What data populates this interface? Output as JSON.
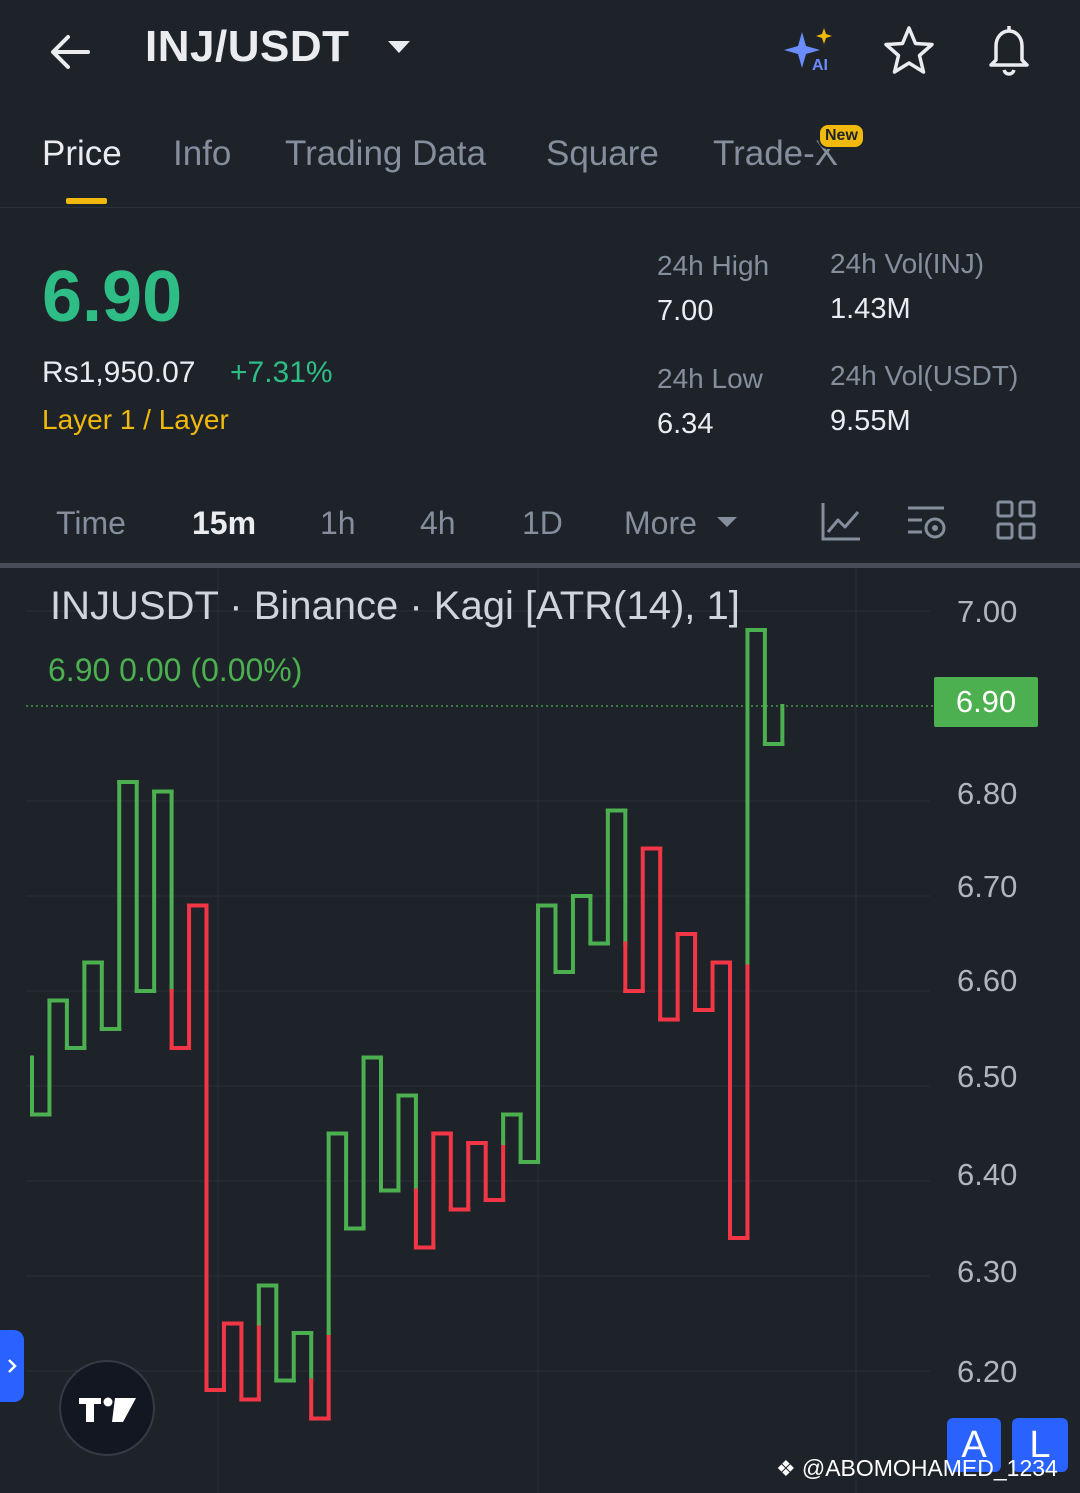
{
  "header": {
    "pair": "INJ/USDT",
    "icons": [
      "back-arrow-icon",
      "ai-sparkle-icon",
      "star-icon",
      "bell-icon"
    ]
  },
  "tabs": [
    {
      "label": "Price",
      "active": true
    },
    {
      "label": "Info"
    },
    {
      "label": "Trading Data"
    },
    {
      "label": "Square"
    },
    {
      "label": "Trade-X",
      "badge": "New"
    }
  ],
  "price": {
    "last": "6.90",
    "fiat": "Rs1,950.07",
    "change_pct": "+7.31%",
    "tag": "Layer 1 / Layer"
  },
  "stats": {
    "high_label": "24h High",
    "high": "7.00",
    "low_label": "24h Low",
    "low": "6.34",
    "vol_base_label": "24h Vol(INJ)",
    "vol_base": "1.43M",
    "vol_quote_label": "24h Vol(USDT)",
    "vol_quote": "9.55M"
  },
  "timeframes": [
    "Time",
    "15m",
    "1h",
    "4h",
    "1D",
    "More"
  ],
  "active_timeframe": "15m",
  "tool_icons": [
    "indicator-chart-icon",
    "chart-settings-icon",
    "layout-grid-icon"
  ],
  "chart": {
    "title": "INJUSDT · Binance · Kagi [ATR(14), 1]",
    "ohlc": "6.90  0.00 (0.00%)",
    "last_label": "6.90",
    "ticks": [
      "7.00",
      "6.80",
      "6.70",
      "6.60",
      "6.50",
      "6.40",
      "6.30",
      "6.20"
    ]
  },
  "chart_data": {
    "type": "line",
    "style": "kagi",
    "title": "INJUSDT · Binance · Kagi [ATR(14), 1]",
    "ylim": [
      6.13,
      7.03
    ],
    "y_ticks": [
      7.0,
      6.8,
      6.7,
      6.6,
      6.5,
      6.4,
      6.3,
      6.2
    ],
    "last_price": 6.9,
    "colors": {
      "yang": "#4caf50",
      "yin": "#f23645"
    },
    "segments": [
      {
        "x": 0,
        "from": 6.53,
        "to": 6.47
      },
      {
        "x": 1,
        "from": 6.47,
        "to": 6.59
      },
      {
        "x": 2,
        "from": 6.59,
        "to": 6.54
      },
      {
        "x": 3,
        "from": 6.54,
        "to": 6.63
      },
      {
        "x": 4,
        "from": 6.63,
        "to": 6.56
      },
      {
        "x": 5,
        "from": 6.56,
        "to": 6.82
      },
      {
        "x": 6,
        "from": 6.82,
        "to": 6.6
      },
      {
        "x": 7,
        "from": 6.6,
        "to": 6.81
      },
      {
        "x": 8,
        "from": 6.81,
        "to": 6.54
      },
      {
        "x": 9,
        "from": 6.54,
        "to": 6.69
      },
      {
        "x": 10,
        "from": 6.69,
        "to": 6.18
      },
      {
        "x": 11,
        "from": 6.18,
        "to": 6.25
      },
      {
        "x": 12,
        "from": 6.25,
        "to": 6.17
      },
      {
        "x": 13,
        "from": 6.17,
        "to": 6.29
      },
      {
        "x": 14,
        "from": 6.29,
        "to": 6.19
      },
      {
        "x": 15,
        "from": 6.19,
        "to": 6.24
      },
      {
        "x": 16,
        "from": 6.24,
        "to": 6.15
      },
      {
        "x": 17,
        "from": 6.15,
        "to": 6.45
      },
      {
        "x": 18,
        "from": 6.45,
        "to": 6.35
      },
      {
        "x": 19,
        "from": 6.35,
        "to": 6.53
      },
      {
        "x": 20,
        "from": 6.53,
        "to": 6.39
      },
      {
        "x": 21,
        "from": 6.39,
        "to": 6.49
      },
      {
        "x": 22,
        "from": 6.49,
        "to": 6.33
      },
      {
        "x": 23,
        "from": 6.33,
        "to": 6.45
      },
      {
        "x": 24,
        "from": 6.45,
        "to": 6.37
      },
      {
        "x": 25,
        "from": 6.37,
        "to": 6.44
      },
      {
        "x": 26,
        "from": 6.44,
        "to": 6.38
      },
      {
        "x": 27,
        "from": 6.38,
        "to": 6.47
      },
      {
        "x": 28,
        "from": 6.47,
        "to": 6.42
      },
      {
        "x": 29,
        "from": 6.42,
        "to": 6.69
      },
      {
        "x": 30,
        "from": 6.69,
        "to": 6.62
      },
      {
        "x": 31,
        "from": 6.62,
        "to": 6.7
      },
      {
        "x": 32,
        "from": 6.7,
        "to": 6.65
      },
      {
        "x": 33,
        "from": 6.65,
        "to": 6.79
      },
      {
        "x": 34,
        "from": 6.79,
        "to": 6.6
      },
      {
        "x": 35,
        "from": 6.6,
        "to": 6.75
      },
      {
        "x": 36,
        "from": 6.75,
        "to": 6.57
      },
      {
        "x": 37,
        "from": 6.57,
        "to": 6.66
      },
      {
        "x": 38,
        "from": 6.66,
        "to": 6.58
      },
      {
        "x": 39,
        "from": 6.58,
        "to": 6.63
      },
      {
        "x": 40,
        "from": 6.63,
        "to": 6.34
      },
      {
        "x": 41,
        "from": 6.34,
        "to": 6.98
      },
      {
        "x": 42,
        "from": 6.98,
        "to": 6.86
      },
      {
        "x": 43,
        "from": 6.86,
        "to": 6.9
      }
    ]
  },
  "overlay": {
    "watermark": "@ABOMOHAMED_1234",
    "btn_a": "A",
    "btn_l": "L"
  }
}
